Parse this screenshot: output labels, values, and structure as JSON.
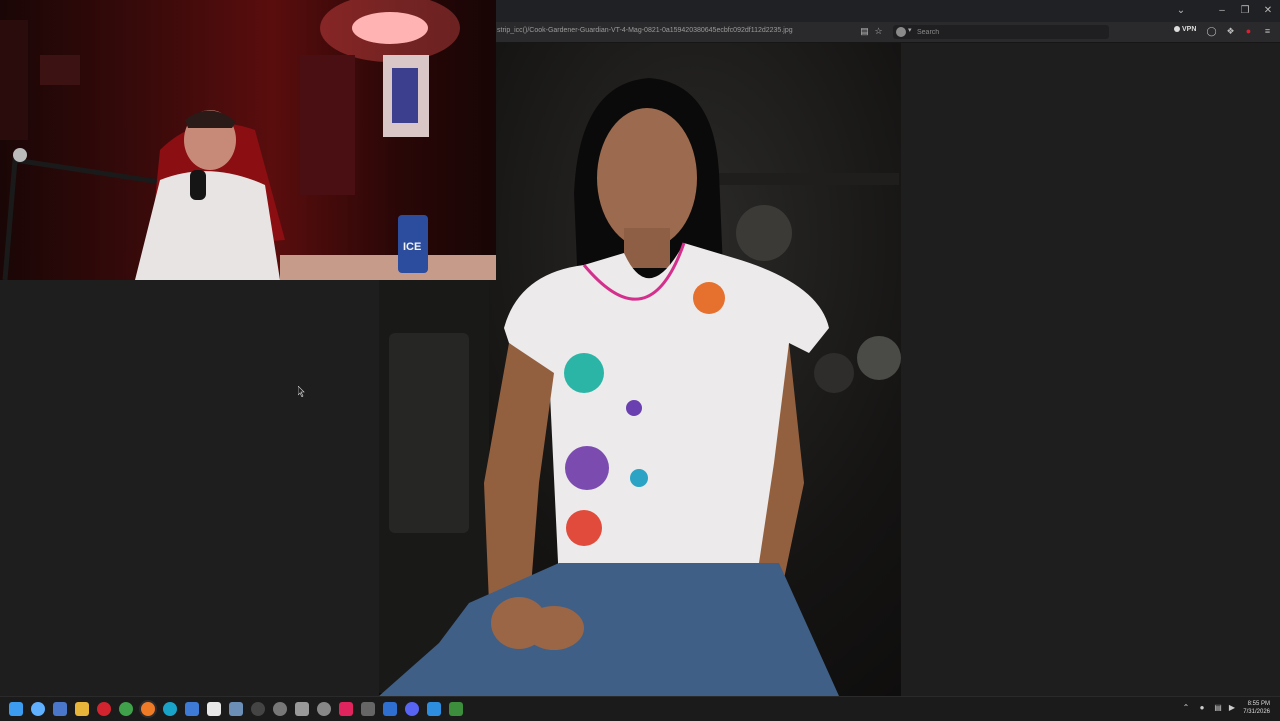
{
  "browser": {
    "url": "strip_icc()/Cook-Gardener-Guardian-VT-4-Mag-0821-0a159420380645ecbfc092df112d2235.jpg",
    "search_placeholder": "Search",
    "vpn_label": "VPN"
  },
  "webcam": {
    "can_label": "ICE"
  },
  "taskbar": {
    "time": "8:55 PM",
    "date": "7/31/2026"
  },
  "colors": {
    "accent": "#e01e2e",
    "taskbar": "#1b1b1b",
    "viewport": "#1e1e1e"
  }
}
